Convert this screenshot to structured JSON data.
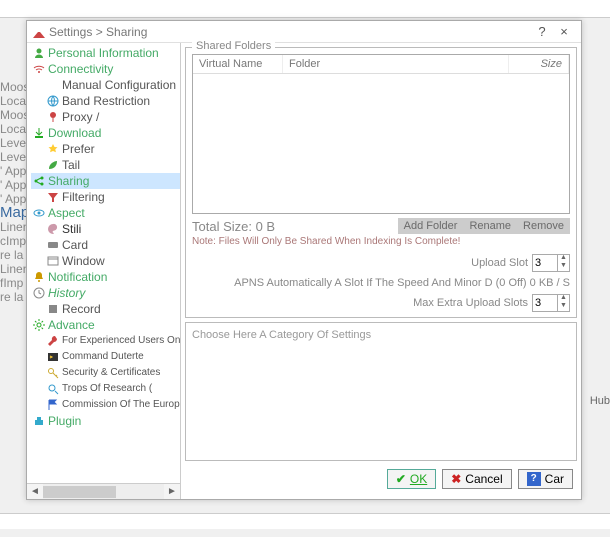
{
  "window": {
    "title": "Settings > Sharing",
    "help": "?",
    "close": "×"
  },
  "bg": {
    "lines": [
      "Moos",
      "Loca",
      "Moos",
      "Loca",
      "Level",
      "Level",
      "' App",
      "' App",
      "' App",
      "Map Sharing",
      "Linen",
      "cImp",
      "re la r",
      "Linen",
      "fImp",
      "re la r"
    ],
    "hub": "Hub"
  },
  "tree": {
    "items": [
      {
        "label": "Personal Information",
        "icon": "person-icon"
      },
      {
        "label": "Connectivity",
        "icon": "wifi-icon",
        "children": [
          {
            "label": "Manual Configuration"
          },
          {
            "label": "Band Restriction",
            "icon": "globe-icon"
          },
          {
            "label": "Proxy /",
            "icon": "pin-icon"
          }
        ]
      },
      {
        "label": "Download",
        "icon": "download-icon",
        "children": [
          {
            "label": "Prefer",
            "icon": "star-icon"
          },
          {
            "label": "Tail",
            "icon": "leaf-icon"
          }
        ]
      },
      {
        "label": "Sharing",
        "icon": "share-icon",
        "selected": true,
        "children": [
          {
            "label": "Filtering",
            "icon": "filter-icon"
          }
        ]
      },
      {
        "label": "Aspect",
        "icon": "eye-icon",
        "children": [
          {
            "label": "Stili",
            "icon": "palette-icon"
          },
          {
            "label": "Card",
            "icon": "card-icon"
          },
          {
            "label": "Window",
            "icon": "window-icon"
          }
        ]
      },
      {
        "label": "Notification",
        "icon": "bell-icon"
      },
      {
        "label": "History",
        "icon": "clock-icon",
        "children": [
          {
            "label": "Record",
            "icon": "record-icon"
          }
        ]
      },
      {
        "label": "Advance",
        "icon": "gear-icon",
        "children": [
          {
            "label": "For Experienced Users Only",
            "icon": "wrench-icon"
          },
          {
            "label": "Command Duterte",
            "icon": "terminal-icon"
          },
          {
            "label": "Security & Certificates",
            "icon": "key-icon"
          },
          {
            "label": "Trops Of Research (",
            "icon": "search-icon"
          },
          {
            "label": "Commission Of The European Communities",
            "icon": "flag-icon"
          }
        ]
      },
      {
        "label": "Plugin",
        "icon": "plugin-icon"
      }
    ]
  },
  "shared": {
    "group_title": "Shared Folders",
    "cols": {
      "vn": "Virtual Name",
      "fd": "Folder",
      "sz": "Size"
    },
    "total_label": "Total Size: 0 B",
    "buttons": {
      "add": "Add Folder",
      "rename": "Rename",
      "remove": "Remove"
    },
    "note": "Note: Files Will Only Be Shared When Indexing Is Complete!",
    "upload_slot_label": "Upload Slot",
    "upload_slot_value": "3",
    "apns_line": "APNS Automatically A Slot If The Speed And Minor D (0 Off) 0 KB / S",
    "apns_value": "0",
    "max_extra_label": "Max Extra Upload Slots",
    "max_extra_value": "3"
  },
  "hint": {
    "text": "Choose Here A Category Of Settings"
  },
  "buttons": {
    "ok": "OK",
    "cancel": "Cancel",
    "help": "Car"
  }
}
